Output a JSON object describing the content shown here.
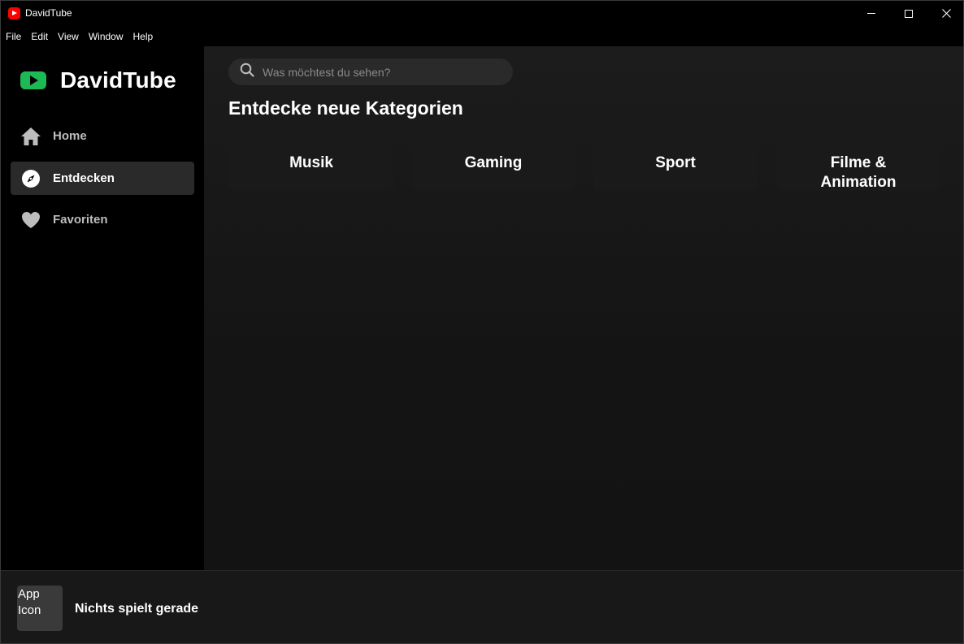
{
  "window": {
    "title": "DavidTube"
  },
  "menu": {
    "items": [
      "File",
      "Edit",
      "View",
      "Window",
      "Help"
    ]
  },
  "sidebar": {
    "logo_text": "DavidTube",
    "items": [
      {
        "label": "Home",
        "icon": "home-icon"
      },
      {
        "label": "Entdecken",
        "icon": "compass-icon",
        "active": true
      },
      {
        "label": "Favoriten",
        "icon": "heart-icon"
      }
    ]
  },
  "main": {
    "search_placeholder": "Was möchtest du sehen?",
    "search_value": "",
    "title": "Entdecke neue Kategorien",
    "categories": [
      "Musik",
      "Gaming",
      "Sport",
      "Filme & Animation"
    ]
  },
  "player": {
    "art_alt": "App Icon",
    "status": "Nichts spielt gerade"
  },
  "colors": {
    "accent_green": "#1db954",
    "app_icon_red": "#ff0000",
    "sidebar_bg": "#000000",
    "main_bg": "#1a1a1a",
    "active_item_bg": "#2a2a2a"
  }
}
